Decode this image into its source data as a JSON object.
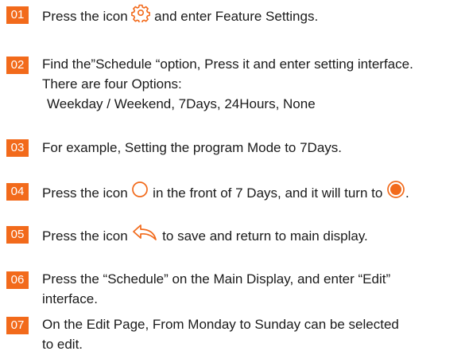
{
  "colors": {
    "accent": "#f26a1b",
    "badge_text": "#ffffff",
    "body_text": "#1a1a1a"
  },
  "steps": [
    {
      "number": "01",
      "before_icon": "Press the icon ",
      "icon": "gear-icon",
      "after_icon": " and enter Feature Settings."
    },
    {
      "number": "02",
      "line1": "Find the”Schedule “option, Press it and enter setting interface.",
      "line2": "There are four Options:",
      "line3": "Weekday / Weekend,  7Days, 24Hours, None"
    },
    {
      "number": "03",
      "line1": "For example, Setting the program Mode to 7Days."
    },
    {
      "number": "04",
      "before_icon": "Press the icon ",
      "icon": "radio-unselected-icon",
      "middle": " in the front of 7 Days, and it will turn to ",
      "icon2": "radio-selected-icon",
      "after_icon": "."
    },
    {
      "number": "05",
      "before_icon": "Press the icon ",
      "icon": "back-arrow-icon",
      "after_icon": " to save and return to main display."
    },
    {
      "number": "06",
      "line1": "Press the “Schedule” on the Main Display, and enter “Edit”",
      "line2": "interface."
    },
    {
      "number": "07",
      "line1": "On the Edit Page, From Monday to Sunday can be selected",
      "line2": "to edit."
    }
  ]
}
